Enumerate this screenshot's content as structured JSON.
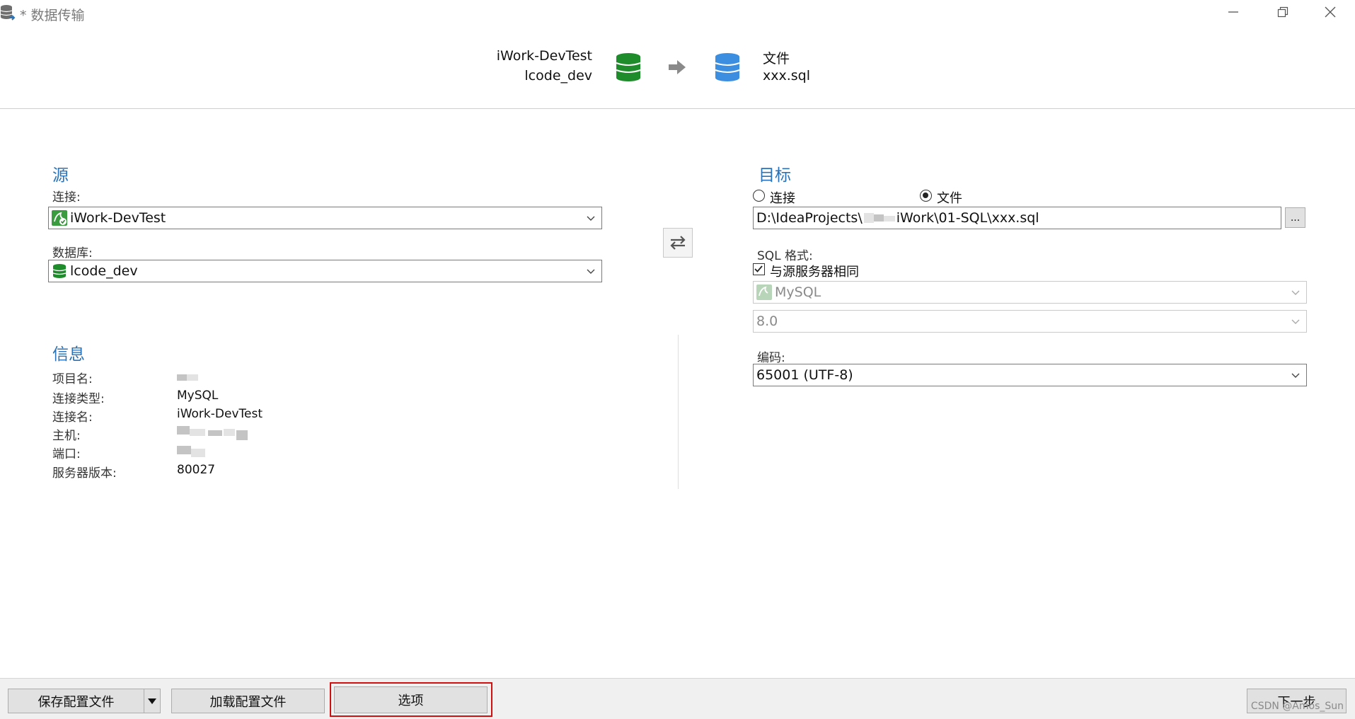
{
  "window": {
    "title": "* 数据传输",
    "controls": [
      "minimize-icon",
      "maximize-icon",
      "close-icon"
    ]
  },
  "header": {
    "source_connection": "iWork-DevTest",
    "source_database": "lcode_dev",
    "target_type": "文件",
    "target_file": "xxx.sql",
    "colors": {
      "source_db": "#1e8c2a",
      "target_db": "#3c8ee0",
      "arrow": "#8a8a8a"
    }
  },
  "source": {
    "heading": "源",
    "connection_label": "连接:",
    "connection_value": "iWork-DevTest",
    "database_label": "数据库:",
    "database_value": "lcode_dev"
  },
  "info": {
    "heading": "信息",
    "rows": [
      {
        "label": "项目名:",
        "value": ""
      },
      {
        "label": "连接类型:",
        "value": "MySQL"
      },
      {
        "label": "连接名:",
        "value": "iWork-DevTest"
      },
      {
        "label": "主机:",
        "value": ""
      },
      {
        "label": "端口:",
        "value": ""
      },
      {
        "label": "服务器版本:",
        "value": "80027"
      }
    ]
  },
  "target": {
    "heading": "目标",
    "radio_connection": "连接",
    "radio_file": "文件",
    "selected": "文件",
    "file_path_prefix": "D:\\IdeaProjects\\",
    "file_path_suffix": "iWork\\01-SQL\\xxx.sql",
    "browse_label": "...",
    "sql_format_label": "SQL 格式:",
    "same_as_source_label": "与源服务器相同",
    "same_as_source_checked": true,
    "server_type_value": "MySQL",
    "server_version_value": "8.0",
    "encoding_label": "编码:",
    "encoding_value": "65001 (UTF-8)"
  },
  "footer": {
    "save_profile_label": "保存配置文件",
    "load_profile_label": "加载配置文件",
    "options_label": "选项",
    "next_label": "下一步",
    "watermark": "CSDN @Amos_Sun",
    "highlight_color": "#d01010"
  }
}
